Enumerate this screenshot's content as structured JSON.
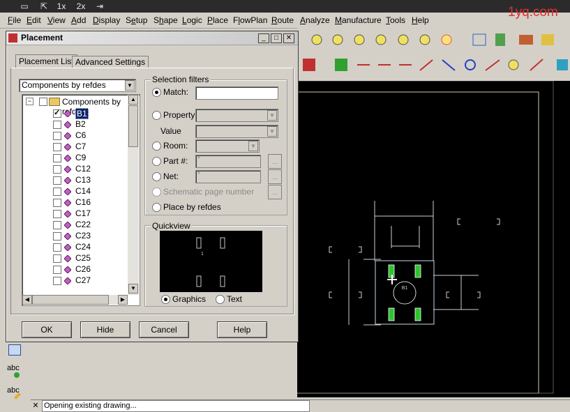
{
  "menu": [
    "File",
    "Edit",
    "View",
    "Add",
    "Display",
    "Setup",
    "Shape",
    "Logic",
    "Place",
    "FlowPlan",
    "Route",
    "Analyze",
    "Manufacture",
    "Tools",
    "Help"
  ],
  "menu_underline_index": [
    0,
    0,
    0,
    0,
    0,
    1,
    1,
    0,
    0,
    1,
    0,
    0,
    0,
    0,
    0
  ],
  "topstrip": {
    "zoom1": "1x",
    "zoom2": "2x"
  },
  "watermark": "1yq.com",
  "dialog": {
    "title": "Placement",
    "tabs": [
      "Placement List",
      "Advanced Settings"
    ],
    "list_type": "Components by refdes",
    "tree_root": "Components by refdes",
    "tree_items": [
      {
        "label": "B1",
        "checked": true,
        "selected": true
      },
      {
        "label": "B2",
        "checked": false
      },
      {
        "label": "C6",
        "checked": false
      },
      {
        "label": "C7",
        "checked": false
      },
      {
        "label": "C9",
        "checked": false
      },
      {
        "label": "C12",
        "checked": false
      },
      {
        "label": "C13",
        "checked": false
      },
      {
        "label": "C14",
        "checked": false
      },
      {
        "label": "C16",
        "checked": false
      },
      {
        "label": "C17",
        "checked": false
      },
      {
        "label": "C22",
        "checked": false
      },
      {
        "label": "C23",
        "checked": false
      },
      {
        "label": "C24",
        "checked": false
      },
      {
        "label": "C25",
        "checked": false
      },
      {
        "label": "C26",
        "checked": false
      },
      {
        "label": "C27",
        "checked": false
      }
    ],
    "selection_filters": {
      "title": "Selection filters",
      "match": "Match:",
      "property": "Property:",
      "value": "Value",
      "room": "Room:",
      "part": "Part #:",
      "part_value": "*",
      "net": "Net:",
      "net_value": "*",
      "schematic": "Schematic page number",
      "place_by_refdes": "Place by refdes",
      "ellipsis": "..."
    },
    "quickview": {
      "title": "Quickview",
      "graphics": "Graphics",
      "text": "Text",
      "part_label": "1"
    },
    "buttons": {
      "ok": "OK",
      "hide": "Hide",
      "cancel": "Cancel",
      "help": "Help"
    }
  },
  "canvas": {
    "part_label": "B1"
  },
  "status": {
    "message": "Opening existing drawing..."
  },
  "left_tools": [
    "abc",
    "abc"
  ],
  "colors": {
    "canvas_bg": "#000000",
    "board_outline": "#d8c8a8",
    "part_pad": "#2ec42e",
    "dim_line": "#d0d0d0"
  }
}
